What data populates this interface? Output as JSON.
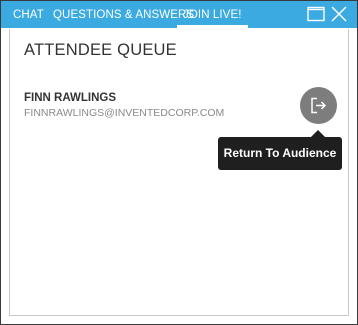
{
  "tabs": [
    {
      "label": "CHAT"
    },
    {
      "label": "QUESTIONS & ANSWERS"
    },
    {
      "label": "JOIN LIVE!",
      "active": true
    }
  ],
  "window_controls": {
    "maximize_icon": "maximize-icon",
    "close_icon": "close-icon"
  },
  "colors": {
    "titlebar": "#3aaae1",
    "button": "#7d7d7d",
    "tooltip": "#1f1f1f"
  },
  "queue": {
    "title": "ATTENDEE QUEUE",
    "attendees": [
      {
        "name": "FINN RAWLINGS",
        "email": "FINNRAWLINGS@INVENTEDCORP.COM",
        "action_icon": "exit-icon"
      }
    ]
  },
  "tooltip": {
    "text": "Return To Audience"
  }
}
